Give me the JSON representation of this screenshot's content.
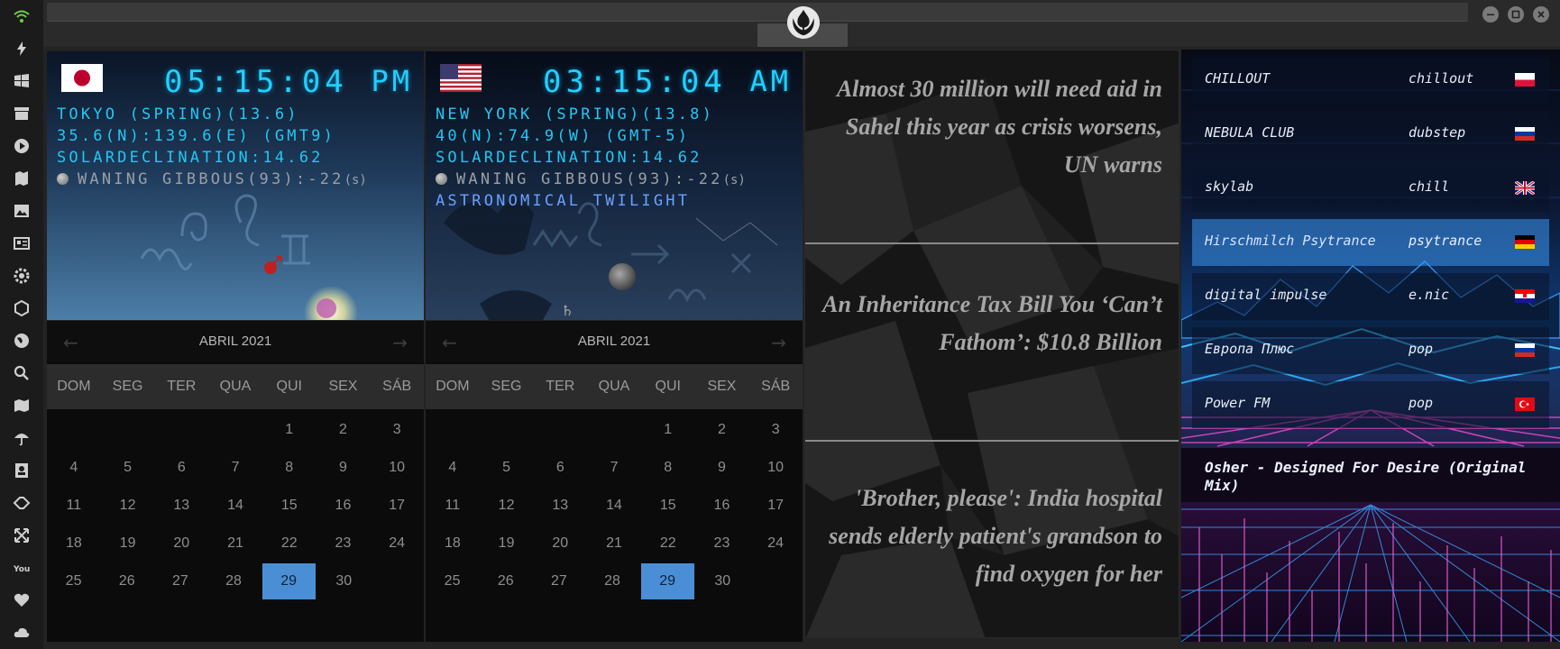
{
  "rail": {
    "icons": [
      "wifi-icon",
      "bolt-icon",
      "windows-icon",
      "archive-icon",
      "play-icon",
      "map-book-icon",
      "image-icon",
      "news-icon",
      "settings-gear-icon",
      "hexagon-icon",
      "globe-icon",
      "search-icon",
      "map-icon",
      "umbrella-icon",
      "contacts-icon",
      "tag-icon",
      "expand-icon",
      "youtube-icon",
      "heart-icon",
      "cloud-icon"
    ]
  },
  "titlebar": {
    "logo": "rebel-alliance-logo",
    "buttons": [
      "minimize-button",
      "maximize-button",
      "close-button"
    ]
  },
  "clocks": [
    {
      "flag": "japan",
      "time": "05:15:04",
      "ampm": "PM",
      "line1": "TOKYO (SPRING)(13.6)",
      "line2": "35.6(N):139.6(E) (GMT9)",
      "line3": "SOLARDECLINATION:14.62",
      "moon": "WANING GIBBOUS(93):-22",
      "moon_unit": "(s)"
    },
    {
      "flag": "usa",
      "time": "03:15:04",
      "ampm": "AM",
      "line1": "NEW YORK (SPRING)(13.8)",
      "line2": "40(N):74.9(W) (GMT-5)",
      "line3": "SOLARDECLINATION:14.62",
      "moon": "WANING GIBBOUS(93):-22",
      "moon_unit": "(s)",
      "twilight": "ASTRONOMICAL TWILIGHT"
    }
  ],
  "calendars": [
    {
      "month": "ABRIL 2021",
      "weekdays": [
        "DOM",
        "SEG",
        "TER",
        "QUA",
        "QUI",
        "SEX",
        "SÁB"
      ],
      "weeks": [
        [
          "",
          "",
          "",
          "",
          "1",
          "2",
          "3"
        ],
        [
          "4",
          "5",
          "6",
          "7",
          "8",
          "9",
          "10"
        ],
        [
          "11",
          "12",
          "13",
          "14",
          "15",
          "16",
          "17"
        ],
        [
          "18",
          "19",
          "20",
          "21",
          "22",
          "23",
          "24"
        ],
        [
          "25",
          "26",
          "27",
          "28",
          "29",
          "30",
          ""
        ]
      ],
      "today": "29"
    },
    {
      "month": "ABRIL 2021",
      "weekdays": [
        "DOM",
        "SEG",
        "TER",
        "QUA",
        "QUI",
        "SEX",
        "SÁB"
      ],
      "weeks": [
        [
          "",
          "",
          "",
          "",
          "1",
          "2",
          "3"
        ],
        [
          "4",
          "5",
          "6",
          "7",
          "8",
          "9",
          "10"
        ],
        [
          "11",
          "12",
          "13",
          "14",
          "15",
          "16",
          "17"
        ],
        [
          "18",
          "19",
          "20",
          "21",
          "22",
          "23",
          "24"
        ],
        [
          "25",
          "26",
          "27",
          "28",
          "29",
          "30",
          ""
        ]
      ],
      "today": "29"
    }
  ],
  "news": {
    "items": [
      "Almost 30 million will need aid in Sahel this year as crisis worsens, UN warns",
      "An Inheritance Tax Bill You ‘Can’t Fathom’: $10.8 Billion",
      "'Brother, please': India hospital sends elderly patient's grandson to find oxygen for her"
    ]
  },
  "radio": {
    "stations": [
      {
        "name": "CHILLOUT",
        "genre": "chillout",
        "flag": "poland",
        "active": false
      },
      {
        "name": "NEBULA CLUB",
        "genre": "dubstep",
        "flag": "russia",
        "active": false
      },
      {
        "name": "skylab",
        "genre": "chill",
        "flag": "uk",
        "active": false
      },
      {
        "name": "Hirschmilch Psytrance",
        "genre": "psytrance",
        "flag": "germany",
        "active": true
      },
      {
        "name": "digital impulse",
        "genre": "e.nic",
        "flag": "croatia",
        "active": false
      },
      {
        "name": "Европа Плюс",
        "genre": "pop",
        "flag": "russia",
        "active": false
      },
      {
        "name": "Power FM",
        "genre": "pop",
        "flag": "turkey",
        "active": false
      }
    ],
    "now_playing": "Osher - Designed For Desire (Original Mix)"
  },
  "colors": {
    "accent_cyan": "#20d0ff",
    "calendar_today": "#4a8fd6",
    "active_station": "#3c96f0"
  }
}
